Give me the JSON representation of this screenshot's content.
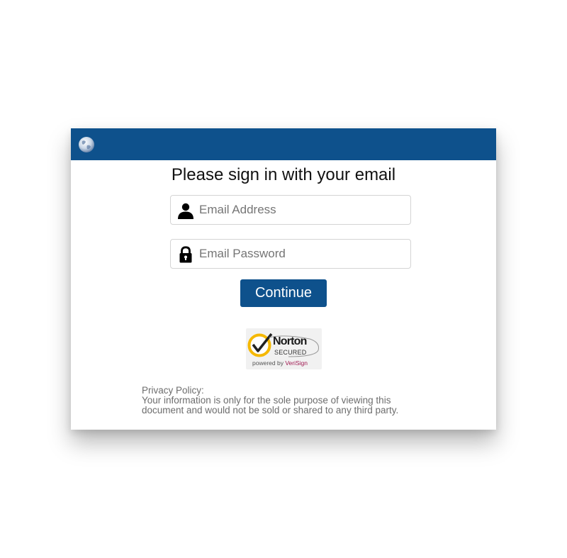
{
  "header": {
    "logo_icon": "globe-icon",
    "color": "#0e518c"
  },
  "form": {
    "title": "Please sign in with your email",
    "email": {
      "icon": "user-icon",
      "placeholder": "Email Address",
      "value": ""
    },
    "password": {
      "icon": "lock-icon",
      "placeholder": "Email Password",
      "value": ""
    },
    "submit_label": "Continue"
  },
  "badge": {
    "title": "Norton",
    "subtitle": "SECURED",
    "powered_by": "powered by",
    "brand": "VeriSign",
    "check_color": "#f5b800"
  },
  "privacy": {
    "heading": "Privacy Policy:",
    "text": "Your information is only for the sole purpose of viewing this document and would not be sold or shared to any third party."
  }
}
